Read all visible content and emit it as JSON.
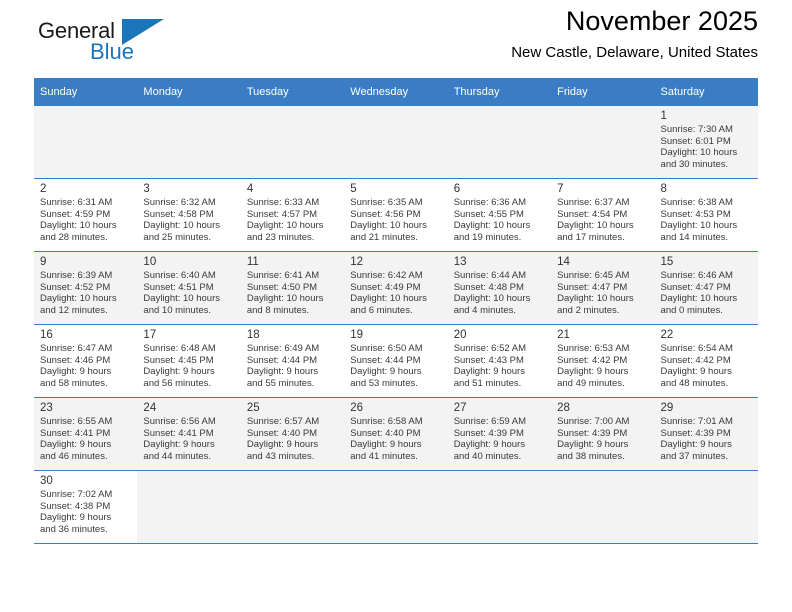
{
  "brand": {
    "name_part1": "General",
    "name_part2": "Blue",
    "triangle_color": "#1b75bb",
    "text_color": "#1a1a1a"
  },
  "header": {
    "title": "November 2025",
    "subtitle": "New Castle, Delaware, United States"
  },
  "theme": {
    "header_bg": "#3b7dc4",
    "header_text": "#ffffff",
    "row_alt_bg": "#f3f3f3",
    "grid_line": "#3b7dc4"
  },
  "weekdays": [
    {
      "label": "Sunday"
    },
    {
      "label": "Monday"
    },
    {
      "label": "Tuesday"
    },
    {
      "label": "Wednesday"
    },
    {
      "label": "Thursday"
    },
    {
      "label": "Friday"
    },
    {
      "label": "Saturday"
    }
  ],
  "weeks": [
    {
      "days": [
        {
          "empty": true
        },
        {
          "empty": true
        },
        {
          "empty": true
        },
        {
          "empty": true
        },
        {
          "empty": true
        },
        {
          "empty": true
        },
        {
          "day": "1",
          "sunrise": "Sunrise: 7:30 AM",
          "sunset": "Sunset: 6:01 PM",
          "daylight1": "Daylight: 10 hours",
          "daylight2": "and 30 minutes."
        }
      ]
    },
    {
      "days": [
        {
          "day": "2",
          "sunrise": "Sunrise: 6:31 AM",
          "sunset": "Sunset: 4:59 PM",
          "daylight1": "Daylight: 10 hours",
          "daylight2": "and 28 minutes."
        },
        {
          "day": "3",
          "sunrise": "Sunrise: 6:32 AM",
          "sunset": "Sunset: 4:58 PM",
          "daylight1": "Daylight: 10 hours",
          "daylight2": "and 25 minutes."
        },
        {
          "day": "4",
          "sunrise": "Sunrise: 6:33 AM",
          "sunset": "Sunset: 4:57 PM",
          "daylight1": "Daylight: 10 hours",
          "daylight2": "and 23 minutes."
        },
        {
          "day": "5",
          "sunrise": "Sunrise: 6:35 AM",
          "sunset": "Sunset: 4:56 PM",
          "daylight1": "Daylight: 10 hours",
          "daylight2": "and 21 minutes."
        },
        {
          "day": "6",
          "sunrise": "Sunrise: 6:36 AM",
          "sunset": "Sunset: 4:55 PM",
          "daylight1": "Daylight: 10 hours",
          "daylight2": "and 19 minutes."
        },
        {
          "day": "7",
          "sunrise": "Sunrise: 6:37 AM",
          "sunset": "Sunset: 4:54 PM",
          "daylight1": "Daylight: 10 hours",
          "daylight2": "and 17 minutes."
        },
        {
          "day": "8",
          "sunrise": "Sunrise: 6:38 AM",
          "sunset": "Sunset: 4:53 PM",
          "daylight1": "Daylight: 10 hours",
          "daylight2": "and 14 minutes."
        }
      ]
    },
    {
      "days": [
        {
          "day": "9",
          "sunrise": "Sunrise: 6:39 AM",
          "sunset": "Sunset: 4:52 PM",
          "daylight1": "Daylight: 10 hours",
          "daylight2": "and 12 minutes."
        },
        {
          "day": "10",
          "sunrise": "Sunrise: 6:40 AM",
          "sunset": "Sunset: 4:51 PM",
          "daylight1": "Daylight: 10 hours",
          "daylight2": "and 10 minutes."
        },
        {
          "day": "11",
          "sunrise": "Sunrise: 6:41 AM",
          "sunset": "Sunset: 4:50 PM",
          "daylight1": "Daylight: 10 hours",
          "daylight2": "and 8 minutes."
        },
        {
          "day": "12",
          "sunrise": "Sunrise: 6:42 AM",
          "sunset": "Sunset: 4:49 PM",
          "daylight1": "Daylight: 10 hours",
          "daylight2": "and 6 minutes."
        },
        {
          "day": "13",
          "sunrise": "Sunrise: 6:44 AM",
          "sunset": "Sunset: 4:48 PM",
          "daylight1": "Daylight: 10 hours",
          "daylight2": "and 4 minutes."
        },
        {
          "day": "14",
          "sunrise": "Sunrise: 6:45 AM",
          "sunset": "Sunset: 4:47 PM",
          "daylight1": "Daylight: 10 hours",
          "daylight2": "and 2 minutes."
        },
        {
          "day": "15",
          "sunrise": "Sunrise: 6:46 AM",
          "sunset": "Sunset: 4:47 PM",
          "daylight1": "Daylight: 10 hours",
          "daylight2": "and 0 minutes."
        }
      ]
    },
    {
      "days": [
        {
          "day": "16",
          "sunrise": "Sunrise: 6:47 AM",
          "sunset": "Sunset: 4:46 PM",
          "daylight1": "Daylight: 9 hours",
          "daylight2": "and 58 minutes."
        },
        {
          "day": "17",
          "sunrise": "Sunrise: 6:48 AM",
          "sunset": "Sunset: 4:45 PM",
          "daylight1": "Daylight: 9 hours",
          "daylight2": "and 56 minutes."
        },
        {
          "day": "18",
          "sunrise": "Sunrise: 6:49 AM",
          "sunset": "Sunset: 4:44 PM",
          "daylight1": "Daylight: 9 hours",
          "daylight2": "and 55 minutes."
        },
        {
          "day": "19",
          "sunrise": "Sunrise: 6:50 AM",
          "sunset": "Sunset: 4:44 PM",
          "daylight1": "Daylight: 9 hours",
          "daylight2": "and 53 minutes."
        },
        {
          "day": "20",
          "sunrise": "Sunrise: 6:52 AM",
          "sunset": "Sunset: 4:43 PM",
          "daylight1": "Daylight: 9 hours",
          "daylight2": "and 51 minutes."
        },
        {
          "day": "21",
          "sunrise": "Sunrise: 6:53 AM",
          "sunset": "Sunset: 4:42 PM",
          "daylight1": "Daylight: 9 hours",
          "daylight2": "and 49 minutes."
        },
        {
          "day": "22",
          "sunrise": "Sunrise: 6:54 AM",
          "sunset": "Sunset: 4:42 PM",
          "daylight1": "Daylight: 9 hours",
          "daylight2": "and 48 minutes."
        }
      ]
    },
    {
      "days": [
        {
          "day": "23",
          "sunrise": "Sunrise: 6:55 AM",
          "sunset": "Sunset: 4:41 PM",
          "daylight1": "Daylight: 9 hours",
          "daylight2": "and 46 minutes."
        },
        {
          "day": "24",
          "sunrise": "Sunrise: 6:56 AM",
          "sunset": "Sunset: 4:41 PM",
          "daylight1": "Daylight: 9 hours",
          "daylight2": "and 44 minutes."
        },
        {
          "day": "25",
          "sunrise": "Sunrise: 6:57 AM",
          "sunset": "Sunset: 4:40 PM",
          "daylight1": "Daylight: 9 hours",
          "daylight2": "and 43 minutes."
        },
        {
          "day": "26",
          "sunrise": "Sunrise: 6:58 AM",
          "sunset": "Sunset: 4:40 PM",
          "daylight1": "Daylight: 9 hours",
          "daylight2": "and 41 minutes."
        },
        {
          "day": "27",
          "sunrise": "Sunrise: 6:59 AM",
          "sunset": "Sunset: 4:39 PM",
          "daylight1": "Daylight: 9 hours",
          "daylight2": "and 40 minutes."
        },
        {
          "day": "28",
          "sunrise": "Sunrise: 7:00 AM",
          "sunset": "Sunset: 4:39 PM",
          "daylight1": "Daylight: 9 hours",
          "daylight2": "and 38 minutes."
        },
        {
          "day": "29",
          "sunrise": "Sunrise: 7:01 AM",
          "sunset": "Sunset: 4:39 PM",
          "daylight1": "Daylight: 9 hours",
          "daylight2": "and 37 minutes."
        }
      ]
    },
    {
      "days": [
        {
          "day": "30",
          "sunrise": "Sunrise: 7:02 AM",
          "sunset": "Sunset: 4:38 PM",
          "daylight1": "Daylight: 9 hours",
          "daylight2": "and 36 minutes."
        },
        {
          "empty": true
        },
        {
          "empty": true
        },
        {
          "empty": true
        },
        {
          "empty": true
        },
        {
          "empty": true
        },
        {
          "empty": true
        }
      ]
    }
  ]
}
